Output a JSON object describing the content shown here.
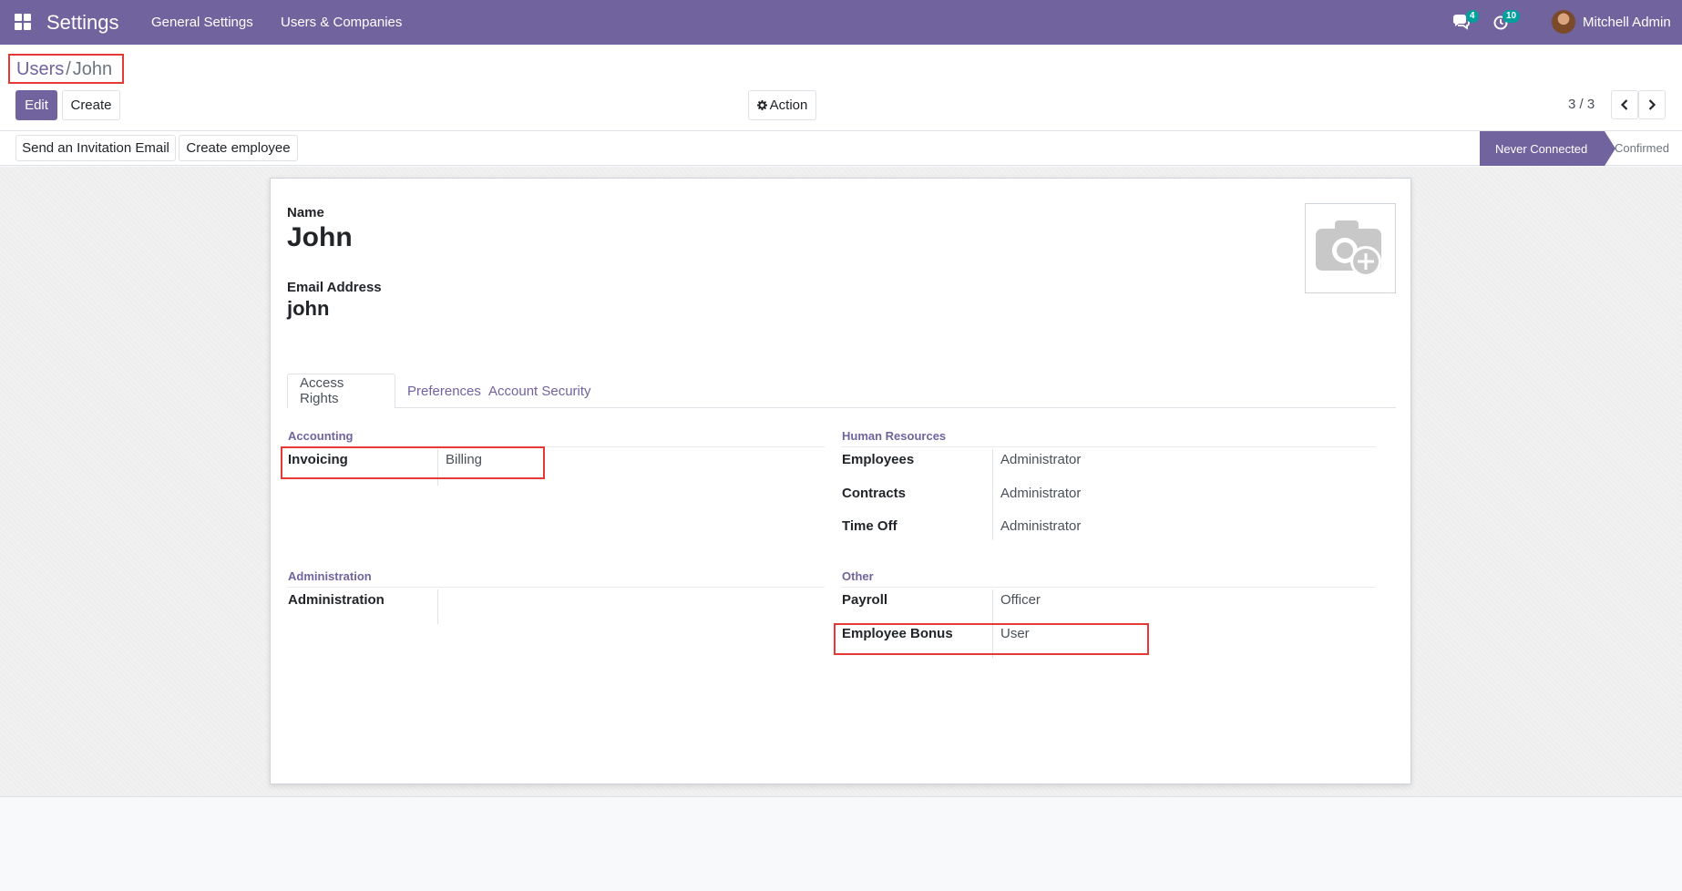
{
  "navbar": {
    "app_title": "Settings",
    "menu": [
      "General Settings",
      "Users & Companies"
    ],
    "messages_count": "4",
    "activities_count": "10",
    "user_name": "Mitchell Admin",
    "color": "#71639e"
  },
  "breadcrumb": {
    "parent": "Users",
    "separator": "/",
    "current": "John"
  },
  "buttons": {
    "edit": "Edit",
    "create": "Create",
    "action": "Action",
    "send_invitation": "Send an Invitation Email",
    "create_employee": "Create employee"
  },
  "pager": {
    "value": "3 / 3"
  },
  "status": {
    "active": "Never Connected",
    "next": "Confirmed"
  },
  "form": {
    "name_label": "Name",
    "name_value": "John",
    "email_label": "Email Address",
    "email_value": "john",
    "tabs": [
      "Access Rights",
      "Preferences",
      "Account Security"
    ],
    "groups": {
      "accounting": {
        "title": "Accounting",
        "fields": [
          {
            "label": "Invoicing",
            "value": "Billing"
          }
        ]
      },
      "human_resources": {
        "title": "Human Resources",
        "fields": [
          {
            "label": "Employees",
            "value": "Administrator"
          },
          {
            "label": "Contracts",
            "value": "Administrator"
          },
          {
            "label": "Time Off",
            "value": "Administrator"
          }
        ]
      },
      "administration": {
        "title": "Administration",
        "fields": [
          {
            "label": "Administration",
            "value": ""
          }
        ]
      },
      "other": {
        "title": "Other",
        "fields": [
          {
            "label": "Payroll",
            "value": "Officer"
          },
          {
            "label": "Employee Bonus",
            "value": "User"
          }
        ]
      }
    }
  },
  "icons": [
    "apps-grid-icon",
    "chat-icon",
    "clock-icon",
    "gear-icon",
    "chevron-left-icon",
    "chevron-right-icon",
    "camera-plus-icon"
  ],
  "highlight_color": "#e53935"
}
